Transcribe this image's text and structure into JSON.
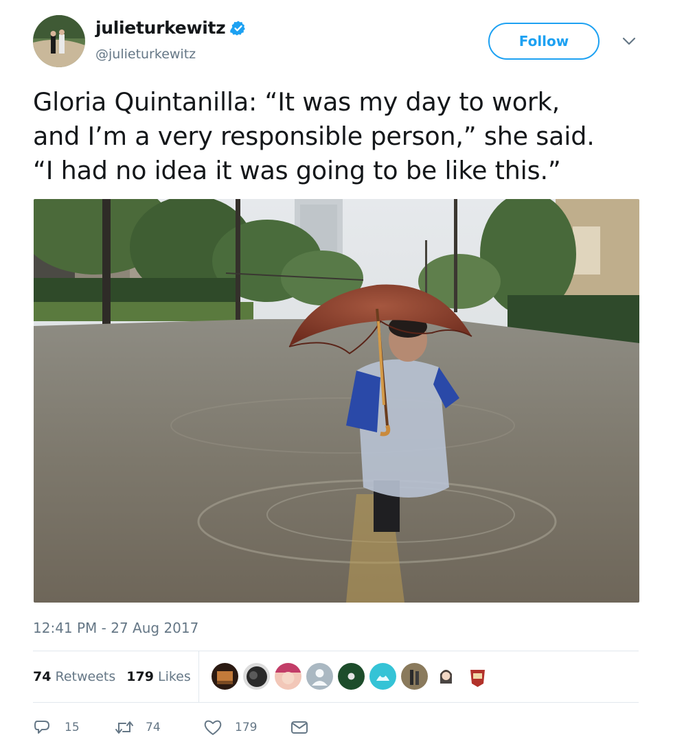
{
  "user": {
    "name": "julieturkewitz",
    "handle": "@julieturkewitz",
    "verified": true,
    "avatar_icon": "profile-photo-icon"
  },
  "follow_label": "Follow",
  "tweet": {
    "lines": [
      "Gloria Quintanilla: “It was my day to work,",
      "and I’m a very responsible person,” she said.",
      "“I had no idea it was going to be like this.”"
    ]
  },
  "timestamp": "12:41 PM - 27 Aug 2017",
  "stats": {
    "retweets_count": "74",
    "retweets_label": "Retweets",
    "likes_count": "179",
    "likes_label": "Likes"
  },
  "actions": {
    "replies": "15",
    "retweets": "74",
    "likes": "179"
  },
  "colors": {
    "accent": "#1da1f2",
    "text": "#14171a",
    "secondary": "#657786"
  }
}
